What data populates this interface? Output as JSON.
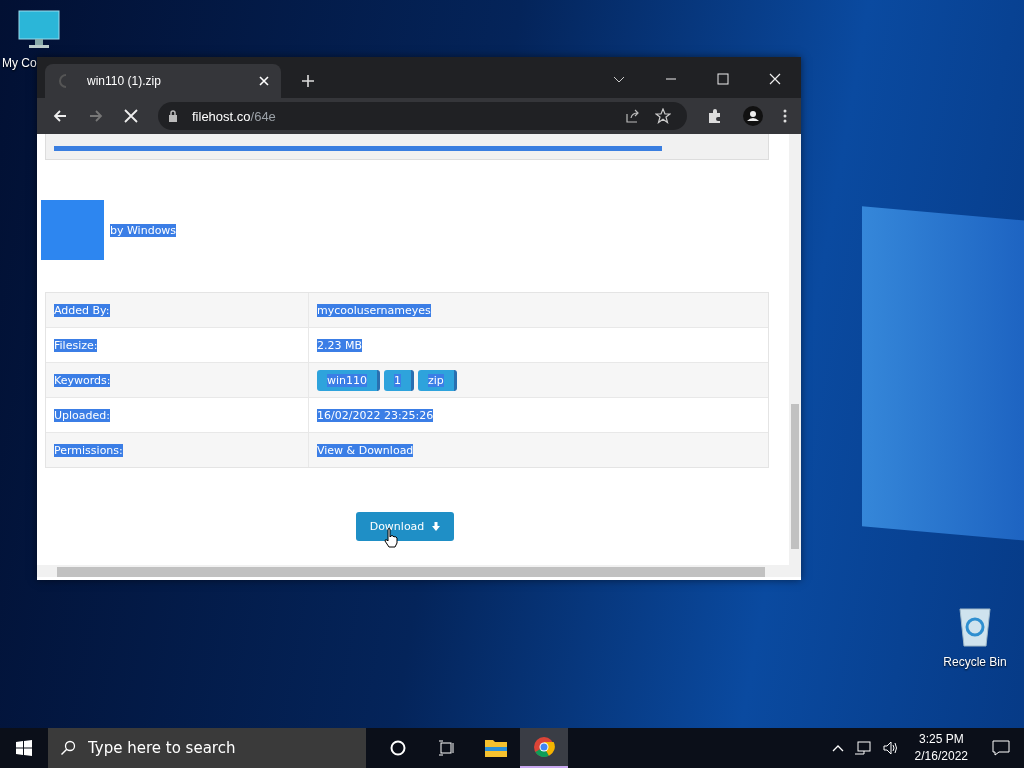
{
  "desktop_icons": [
    {
      "kind": "computer",
      "label": "My Co"
    },
    {
      "kind": "recycle",
      "label": "Recycle Bin"
    }
  ],
  "browser": {
    "tab": {
      "title": "win110 (1).zip",
      "loading": true
    },
    "address": {
      "host": "filehost.co",
      "path": "/64e"
    },
    "page": {
      "text_selected": true,
      "uploader": "by Windows",
      "details": [
        {
          "label": "Added By:",
          "value": "mycoolusernameyes"
        },
        {
          "label": "Filesize:",
          "value": "2.23 MB"
        },
        {
          "label": "Keywords:",
          "tags": [
            "win110",
            "1",
            "zip"
          ]
        },
        {
          "label": "Uploaded:",
          "value": "16/02/2022 23:25:26"
        },
        {
          "label": "Permissions:",
          "value": "View & Download"
        }
      ],
      "download_button": "Download"
    }
  },
  "taskbar": {
    "search_placeholder": "Type here to search",
    "apps": [
      {
        "kind": "explorer",
        "selected": false
      },
      {
        "kind": "chrome",
        "selected": true
      }
    ],
    "time": "3:25 PM",
    "date": "2/16/2022"
  }
}
